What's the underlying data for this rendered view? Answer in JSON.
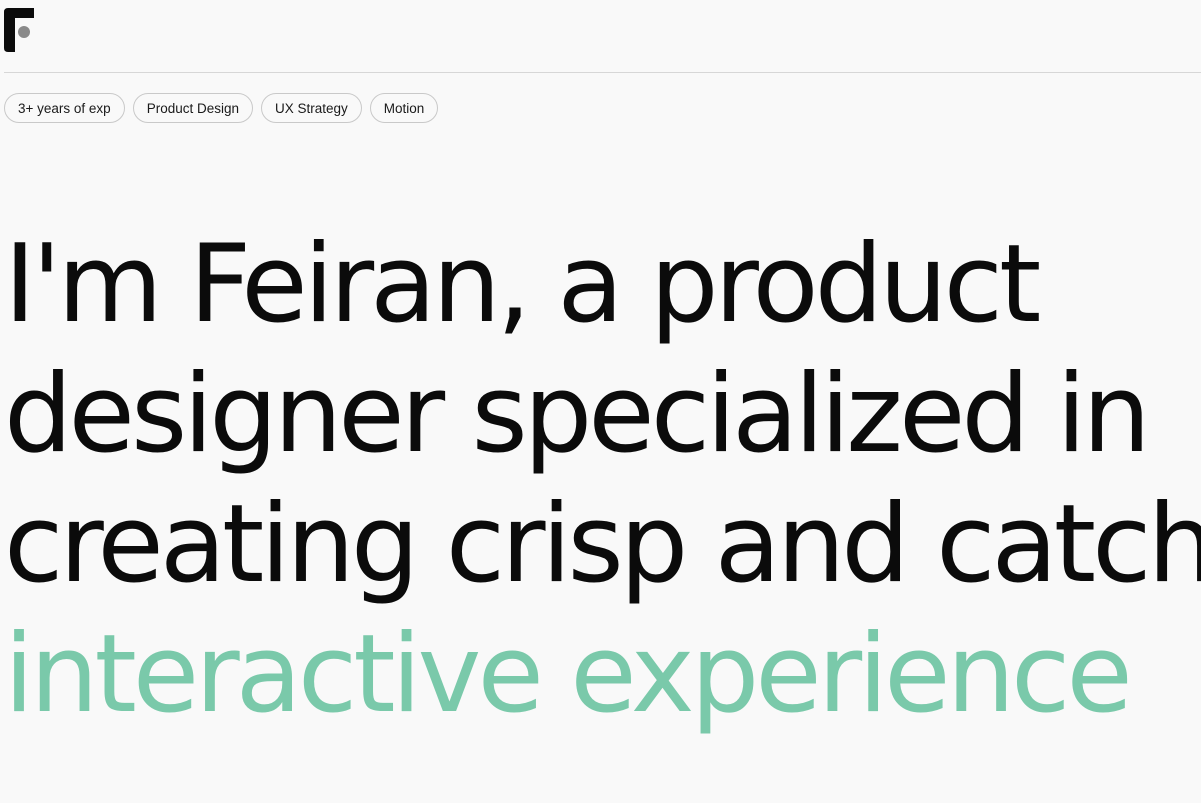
{
  "header": {
    "logo_icon": "f-monogram-logo"
  },
  "tags": [
    {
      "label": "3+ years of exp"
    },
    {
      "label": "Product Design"
    },
    {
      "label": "UX Strategy"
    },
    {
      "label": "Motion"
    }
  ],
  "hero": {
    "line1": "I'm Feiran, a product",
    "line2": "designer specialized in",
    "line3": "creating crisp and catchy",
    "line4": "interactive experience"
  },
  "colors": {
    "background": "#f9f9f9",
    "text": "#0b0b0b",
    "accent": "#7ac9aa"
  }
}
